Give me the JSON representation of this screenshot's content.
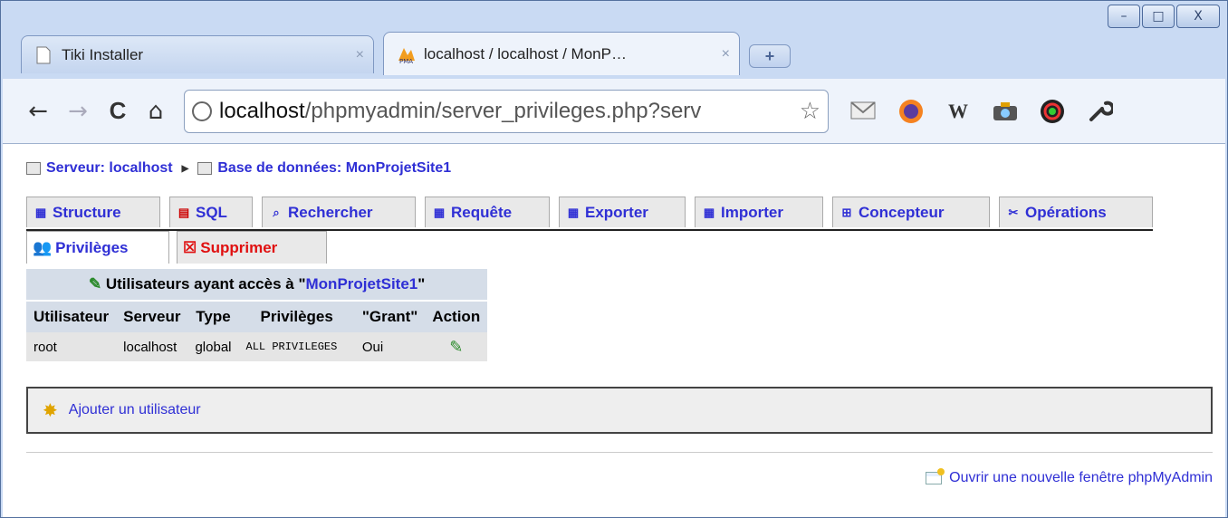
{
  "browser": {
    "tabs": [
      {
        "title": "Tiki Installer",
        "icon": "page-icon",
        "close": "×",
        "active": false
      },
      {
        "title": "localhost / localhost / MonP…",
        "icon": "pma-icon",
        "close": "×",
        "active": true
      }
    ],
    "new_tab": "+",
    "window_controls": {
      "minimize": "–",
      "maximize": "□",
      "close": "X"
    },
    "nav": {
      "back": "←",
      "forward": "→",
      "reload": "C",
      "home": "⌂"
    },
    "address": {
      "host": "localhost",
      "path": "/phpmyadmin/server_privileges.php?serv",
      "star": "☆"
    },
    "extensions": [
      "mail-icon",
      "tv-icon",
      "W",
      "camera-icon",
      "color-wheel-icon",
      "wrench-icon"
    ]
  },
  "page": {
    "breadcrumb": {
      "server": "Serveur: localhost",
      "database": "Base de données: MonProjetSite1"
    },
    "tabs_row1": [
      {
        "label": "Structure",
        "icon": "structure-icon"
      },
      {
        "label": "SQL",
        "icon": "sql-icon"
      },
      {
        "label": "Rechercher",
        "icon": "search-icon"
      },
      {
        "label": "Requête",
        "icon": "query-icon"
      },
      {
        "label": "Exporter",
        "icon": "export-icon"
      },
      {
        "label": "Importer",
        "icon": "import-icon"
      },
      {
        "label": "Concepteur",
        "icon": "designer-icon"
      },
      {
        "label": "Opérations",
        "icon": "operations-icon"
      }
    ],
    "tabs_row2": [
      {
        "label": "Privilèges",
        "icon": "privileges-icon",
        "active": true
      },
      {
        "label": "Supprimer",
        "icon": "delete-icon",
        "active": false
      }
    ],
    "users_table": {
      "caption_prefix": "Utilisateurs ayant accès à \"",
      "caption_db": "MonProjetSite1",
      "caption_suffix": "\"",
      "headers": [
        "Utilisateur",
        "Serveur",
        "Type",
        "Privilèges",
        "\"Grant\"",
        "Action"
      ],
      "rows": [
        {
          "user": "root",
          "server": "localhost",
          "type": "global",
          "privileges": "ALL PRIVILEGES",
          "grant": "Oui",
          "action": "edit-privileges-icon"
        }
      ]
    },
    "add_user": "Ajouter un utilisateur",
    "new_window": "Ouvrir une nouvelle fenêtre phpMyAdmin"
  },
  "colors": {
    "link": "#2f2fd5",
    "danger": "#e01010",
    "table_header": "#d5dde8",
    "table_row": "#e5e5e5"
  }
}
